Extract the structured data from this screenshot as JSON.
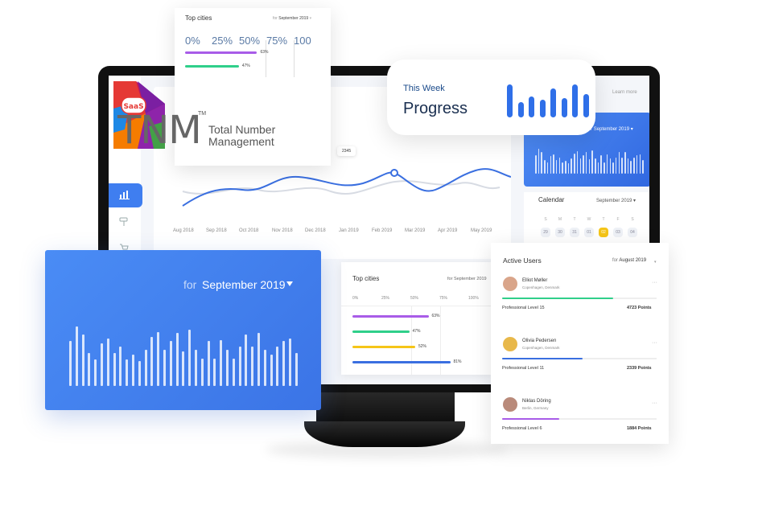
{
  "main_chart": {
    "months": [
      "Aug 2018",
      "Sep 2018",
      "Oct 2018",
      "Nov 2018",
      "Dec 2018",
      "Jan 2019",
      "Feb 2019",
      "Mar 2019",
      "Apr 2019",
      "May 2019"
    ],
    "tooltip": "2345"
  },
  "screen": {
    "learn_more": "Learn more",
    "blue_card": {
      "for_label": "for",
      "month": "September 2019"
    },
    "calendar": {
      "title": "Calendar",
      "month": "September 2019",
      "days": [
        "S",
        "M",
        "T",
        "W",
        "T",
        "F",
        "S"
      ],
      "nums": [
        "29",
        "30",
        "31",
        "01",
        "02",
        "03",
        "04"
      ],
      "selected": "02"
    }
  },
  "top_cities_card": {
    "title": "Top cities",
    "for_label": "for",
    "month": "September 2019",
    "ticks": [
      "0%",
      "25%",
      "50%",
      "75%",
      "100"
    ],
    "bars": [
      {
        "value": 63,
        "label": "63%",
        "color": "#a85ce8"
      },
      {
        "value": 47,
        "label": "47%",
        "color": "#2fcf8a"
      }
    ]
  },
  "brand": {
    "badge": "SaaS",
    "logo": "TNM",
    "tm": "TM",
    "line1": "Total Number",
    "line2": "Management"
  },
  "this_week": {
    "label": "This Week",
    "title": "Progress",
    "bars": [
      0.85,
      0.4,
      0.55,
      0.45,
      0.75,
      0.5,
      0.85,
      0.6
    ]
  },
  "blue_card": {
    "for_label": "for",
    "month": "September 2019",
    "bars": [
      0.68,
      0.9,
      0.78,
      0.5,
      0.4,
      0.65,
      0.72,
      0.5,
      0.6,
      0.4,
      0.48,
      0.38,
      0.55,
      0.75,
      0.82,
      0.55,
      0.68,
      0.8,
      0.52,
      0.85,
      0.55,
      0.42,
      0.68,
      0.42,
      0.7,
      0.55,
      0.42,
      0.6,
      0.78,
      0.6,
      0.8,
      0.55,
      0.48,
      0.6,
      0.68,
      0.72,
      0.5
    ]
  },
  "mid_card": {
    "title": "Top cities",
    "for_label": "for",
    "month": "September 2019",
    "ticks": [
      "0%",
      "25%",
      "50%",
      "75%",
      "100%"
    ],
    "bars": [
      {
        "value": 63,
        "label": "63%",
        "color": "#a85ce8"
      },
      {
        "value": 47,
        "label": "47%",
        "color": "#2fcf8a"
      },
      {
        "value": 52,
        "label": "52%",
        "color": "#f5c518"
      },
      {
        "value": 81,
        "label": "81%",
        "color": "#3a6fe0"
      }
    ]
  },
  "active_users": {
    "title": "Active Users",
    "for_label": "for",
    "month": "August 2019",
    "users": [
      {
        "name": "Elliot Møller",
        "location": "Copenhagen, Denmark",
        "level": "Professional Level 15",
        "points": "4723 Points",
        "progress": 0.72,
        "color": "#2fcf8a"
      },
      {
        "name": "Olivia Pedersen",
        "location": "Copenhagen, Denmark",
        "level": "Professional Level 11",
        "points": "2339 Points",
        "progress": 0.52,
        "color": "#3a6fe0"
      },
      {
        "name": "Niklas Döring",
        "location": "Berlin, Germany",
        "level": "Professional Level 6",
        "points": "1884 Points",
        "progress": 0.37,
        "color": "#a85ce8"
      }
    ]
  }
}
